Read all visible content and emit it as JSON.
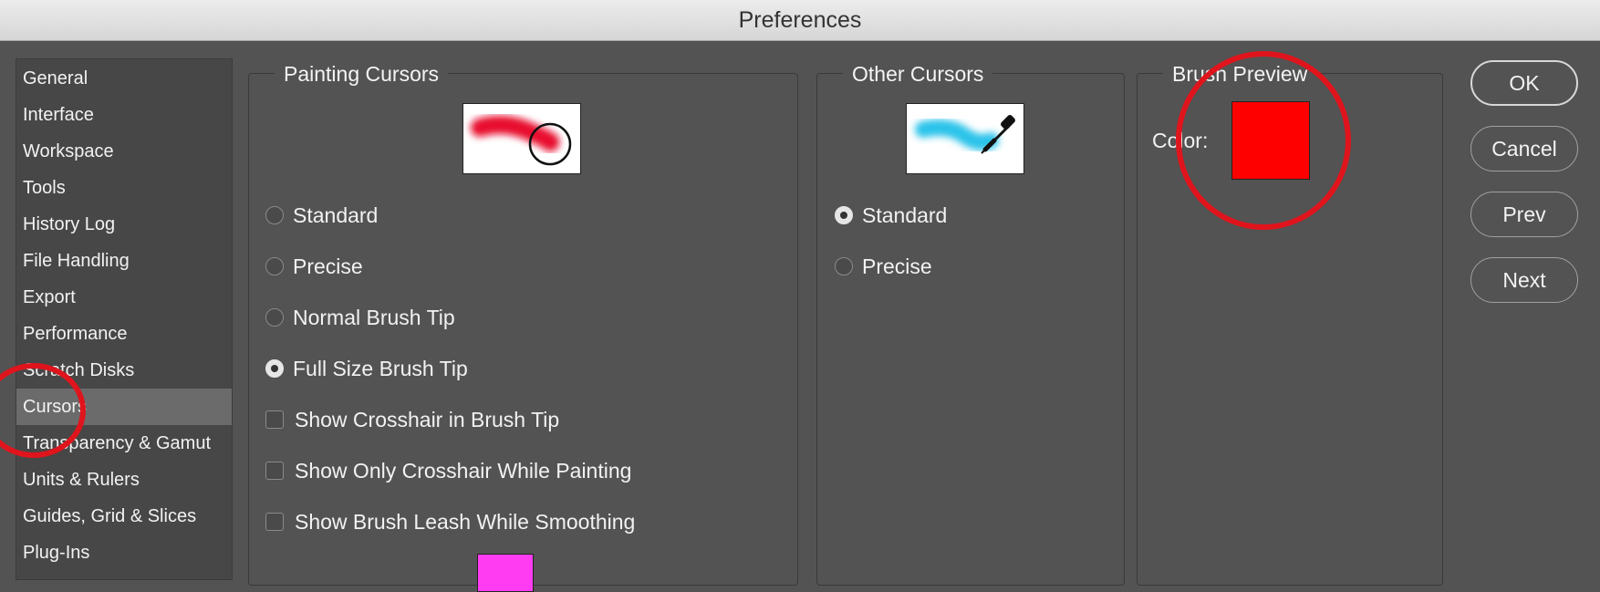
{
  "window": {
    "title": "Preferences"
  },
  "sidebar": {
    "items": [
      {
        "label": "General"
      },
      {
        "label": "Interface"
      },
      {
        "label": "Workspace"
      },
      {
        "label": "Tools"
      },
      {
        "label": "History Log"
      },
      {
        "label": "File Handling"
      },
      {
        "label": "Export"
      },
      {
        "label": "Performance"
      },
      {
        "label": "Scratch Disks"
      },
      {
        "label": "Cursors",
        "selected": true
      },
      {
        "label": "Transparency & Gamut"
      },
      {
        "label": "Units & Rulers"
      },
      {
        "label": "Guides, Grid & Slices"
      },
      {
        "label": "Plug-Ins"
      }
    ]
  },
  "painting_cursors": {
    "title": "Painting Cursors",
    "preview_brush_color": "#e8102e",
    "options": [
      {
        "label": "Standard",
        "checked": false
      },
      {
        "label": "Precise",
        "checked": false
      },
      {
        "label": "Normal Brush Tip",
        "checked": false
      },
      {
        "label": "Full Size Brush Tip",
        "checked": true
      }
    ],
    "checkboxes": [
      {
        "label": "Show Crosshair in Brush Tip",
        "checked": false
      },
      {
        "label": "Show Only Crosshair While Painting",
        "checked": false
      },
      {
        "label": "Show Brush Leash While Smoothing",
        "checked": false
      }
    ],
    "leash_color": "#ff3cf2"
  },
  "other_cursors": {
    "title": "Other Cursors",
    "preview_brush_color": "#2cc3ea",
    "options": [
      {
        "label": "Standard",
        "checked": true
      },
      {
        "label": "Precise",
        "checked": false
      }
    ]
  },
  "brush_preview": {
    "title": "Brush Preview",
    "color_label": "Color:",
    "color": "#ff0000"
  },
  "buttons": {
    "ok": "OK",
    "cancel": "Cancel",
    "prev": "Prev",
    "next": "Next"
  },
  "annotation_color": "#e0141c"
}
